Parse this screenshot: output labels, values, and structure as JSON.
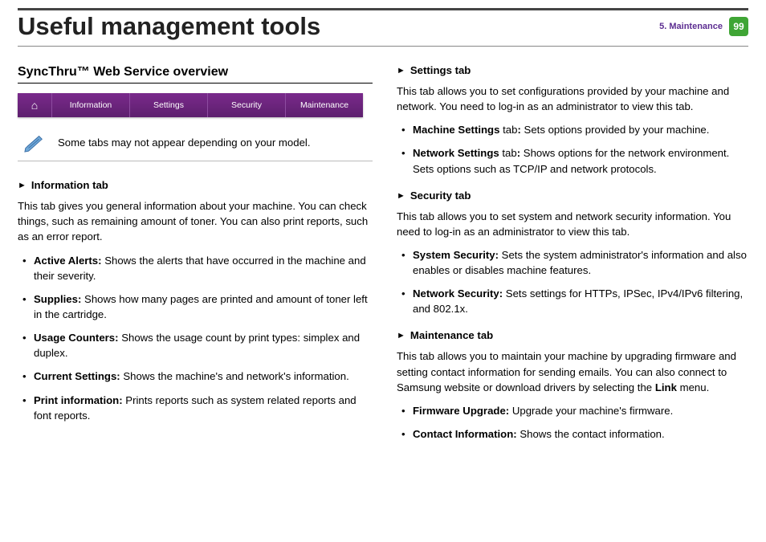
{
  "header": {
    "title": "Useful management tools",
    "chapter": "5.  Maintenance",
    "page_number": "99"
  },
  "left": {
    "overview_heading": "SyncThru™ Web Service overview",
    "tabbar": {
      "home_glyph": "⌂",
      "items": [
        "Information",
        "Settings",
        "Security",
        "Maintenance"
      ]
    },
    "note_text": "Some tabs may not appear depending on your model.",
    "info_tab": {
      "heading": "Information tab",
      "intro": "This tab gives you general information about your machine. You can check things, such as remaining amount of toner. You can also print reports, such as an error report.",
      "items": [
        {
          "term": "Active Alerts:",
          "desc": " Shows the alerts that have occurred in the machine and their severity."
        },
        {
          "term": "Supplies:",
          "desc": " Shows how many pages are printed and amount of toner left in the cartridge."
        },
        {
          "term": "Usage Counters:",
          "desc": " Shows the usage count by print types: simplex and duplex."
        },
        {
          "term": "Current Settings:",
          "desc": " Shows the machine's and network's information."
        },
        {
          "term": "Print information:",
          "desc": " Prints reports such as system related reports and font reports."
        }
      ]
    }
  },
  "right": {
    "settings_tab": {
      "heading": "Settings tab",
      "intro": "This tab allows you to set configurations provided by your machine and network. You need to log-in as an administrator to view this tab.",
      "items": [
        {
          "term": "Machine Settings",
          "mid": " tab",
          "desc": " Sets options provided by your machine."
        },
        {
          "term": "Network Settings",
          "mid": " tab",
          "desc": " Shows options for the network environment. Sets options such as TCP/IP and network protocols."
        }
      ]
    },
    "security_tab": {
      "heading": "Security tab",
      "intro": "This tab allows you to set system and network security information. You need to log-in as an administrator to view this tab.",
      "items": [
        {
          "term": "System Security:",
          "desc": " Sets the system administrator's information and also enables or disables machine features."
        },
        {
          "term": "Network Security:",
          "desc": " Sets settings for HTTPs, IPSec, IPv4/IPv6 filtering, and 802.1x."
        }
      ]
    },
    "maintenance_tab": {
      "heading": "Maintenance tab",
      "intro_a": "This tab allows you to maintain your machine by upgrading firmware and setting contact information for sending emails. You can also connect to Samsung website or download drivers by selecting the ",
      "intro_link": "Link",
      "intro_b": " menu.",
      "items": [
        {
          "term": "Firmware Upgrade:",
          "desc": " Upgrade your machine's firmware."
        },
        {
          "term": "Contact Information:",
          "desc": " Shows the contact information."
        }
      ]
    }
  }
}
